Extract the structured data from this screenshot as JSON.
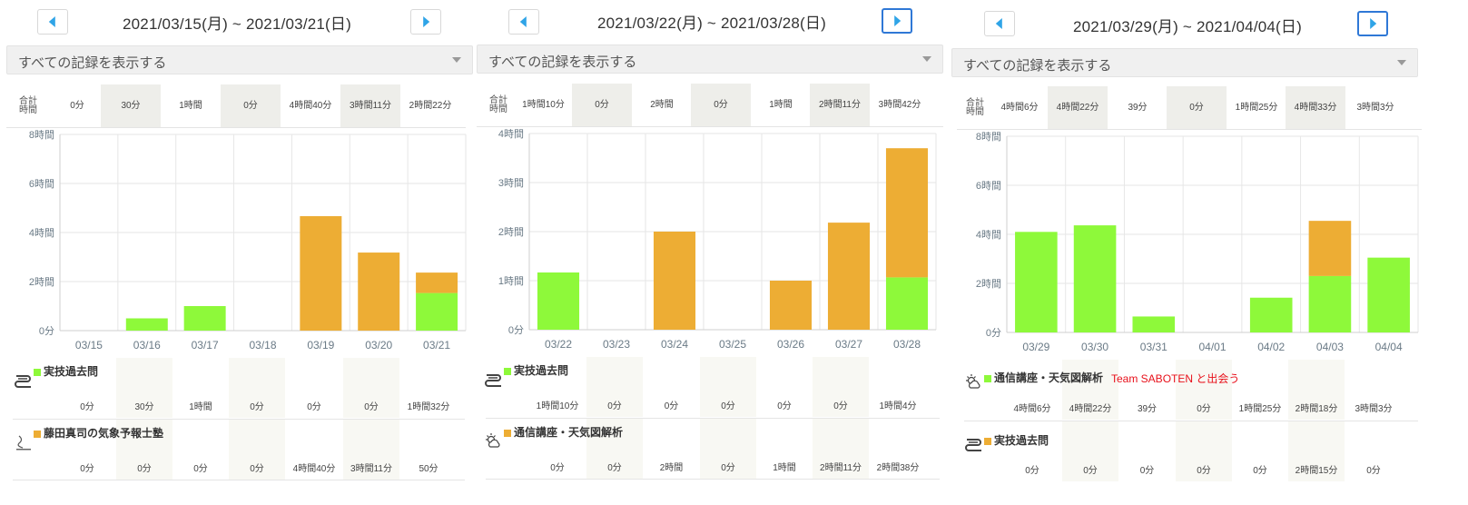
{
  "colors": {
    "green": "#8ef93a",
    "orange": "#edad34",
    "nav_arrow": "#2fa4e7",
    "active_border": "#2f78d6",
    "note": "#e8101a"
  },
  "icons": {
    "prev": "left-triangle-icon",
    "next": "right-triangle-icon",
    "select": "caret-down-icon",
    "book": "book-icon",
    "weather": "sun-cloud-icon",
    "logo": "school-logo-icon"
  },
  "total_label": "合計\n時間",
  "panels": [
    {
      "range": "2021/03/15(月) ~ 2021/03/21(日)",
      "filter": "すべての記録を表示する",
      "totals": [
        "0分",
        "30分",
        "1時間",
        "0分",
        "4時間40分",
        "3時間11分",
        "2時間22分"
      ],
      "records": [
        {
          "name": "実技過去問",
          "color": "green",
          "icon": "book-icon",
          "values": [
            "0分",
            "30分",
            "1時間",
            "0分",
            "0分",
            "0分",
            "1時間32分"
          ]
        },
        {
          "name": "藤田真司の気象予報士塾",
          "color": "orange",
          "icon": "school-logo-icon",
          "values": [
            "0分",
            "0分",
            "0分",
            "0分",
            "4時間40分",
            "3時間11分",
            "50分"
          ]
        }
      ]
    },
    {
      "range": "2021/03/22(月) ~ 2021/03/28(日)",
      "filter": "すべての記録を表示する",
      "totals": [
        "1時間10分",
        "0分",
        "2時間",
        "0分",
        "1時間",
        "2時間11分",
        "3時間42分"
      ],
      "records": [
        {
          "name": "実技過去問",
          "color": "green",
          "icon": "book-icon",
          "values": [
            "1時間10分",
            "0分",
            "0分",
            "0分",
            "0分",
            "0分",
            "1時間4分"
          ]
        },
        {
          "name": "通信講座・天気図解析",
          "color": "orange",
          "icon": "sun-cloud-icon",
          "values": [
            "0分",
            "0分",
            "2時間",
            "0分",
            "1時間",
            "2時間11分",
            "2時間38分"
          ]
        }
      ]
    },
    {
      "range": "2021/03/29(月) ~ 2021/04/04(日)",
      "filter": "すべての記録を表示する",
      "totals": [
        "4時間6分",
        "4時間22分",
        "39分",
        "0分",
        "1時間25分",
        "4時間33分",
        "3時間3分"
      ],
      "note": "Team SABOTEN と出会う",
      "records": [
        {
          "name": "通信講座・天気図解析",
          "color": "green",
          "icon": "sun-cloud-icon",
          "values": [
            "4時間6分",
            "4時間22分",
            "39分",
            "0分",
            "1時間25分",
            "2時間18分",
            "3時間3分"
          ]
        },
        {
          "name": "実技過去問",
          "color": "orange",
          "icon": "book-icon",
          "values": [
            "0分",
            "0分",
            "0分",
            "0分",
            "0分",
            "2時間15分",
            "0分"
          ]
        }
      ]
    }
  ],
  "chart_data": [
    {
      "type": "bar",
      "stacked": true,
      "categories": [
        "03/15",
        "03/16",
        "03/17",
        "03/18",
        "03/19",
        "03/20",
        "03/21"
      ],
      "y_ticks": [
        "0分",
        "2時間",
        "4時間",
        "6時間",
        "8時間"
      ],
      "ylim_hours": [
        0,
        8
      ],
      "series": [
        {
          "name": "実技過去問",
          "color": "green",
          "values": [
            0,
            0.5,
            1.0,
            0,
            0,
            0,
            1.533
          ]
        },
        {
          "name": "藤田真司の気象予報士塾",
          "color": "orange",
          "values": [
            0,
            0,
            0,
            0,
            4.667,
            3.183,
            0.833
          ]
        }
      ]
    },
    {
      "type": "bar",
      "stacked": true,
      "categories": [
        "03/22",
        "03/23",
        "03/24",
        "03/25",
        "03/26",
        "03/27",
        "03/28"
      ],
      "y_ticks": [
        "0分",
        "1時間",
        "2時間",
        "3時間",
        "4時間"
      ],
      "ylim_hours": [
        0,
        4
      ],
      "series": [
        {
          "name": "実技過去問",
          "color": "green",
          "values": [
            1.167,
            0,
            0,
            0,
            0,
            0,
            1.067
          ]
        },
        {
          "name": "通信講座・天気図解析",
          "color": "orange",
          "values": [
            0,
            0,
            2.0,
            0,
            1.0,
            2.183,
            2.633
          ]
        }
      ]
    },
    {
      "type": "bar",
      "stacked": true,
      "categories": [
        "03/29",
        "03/30",
        "03/31",
        "04/01",
        "04/02",
        "04/03",
        "04/04"
      ],
      "y_ticks": [
        "0分",
        "2時間",
        "4時間",
        "6時間",
        "8時間"
      ],
      "ylim_hours": [
        0,
        8
      ],
      "series": [
        {
          "name": "通信講座・天気図解析",
          "color": "green",
          "values": [
            4.1,
            4.367,
            0.65,
            0,
            1.417,
            2.3,
            3.05
          ]
        },
        {
          "name": "実技過去問",
          "color": "orange",
          "values": [
            0,
            0,
            0,
            0,
            0,
            2.25,
            0
          ]
        }
      ]
    }
  ]
}
